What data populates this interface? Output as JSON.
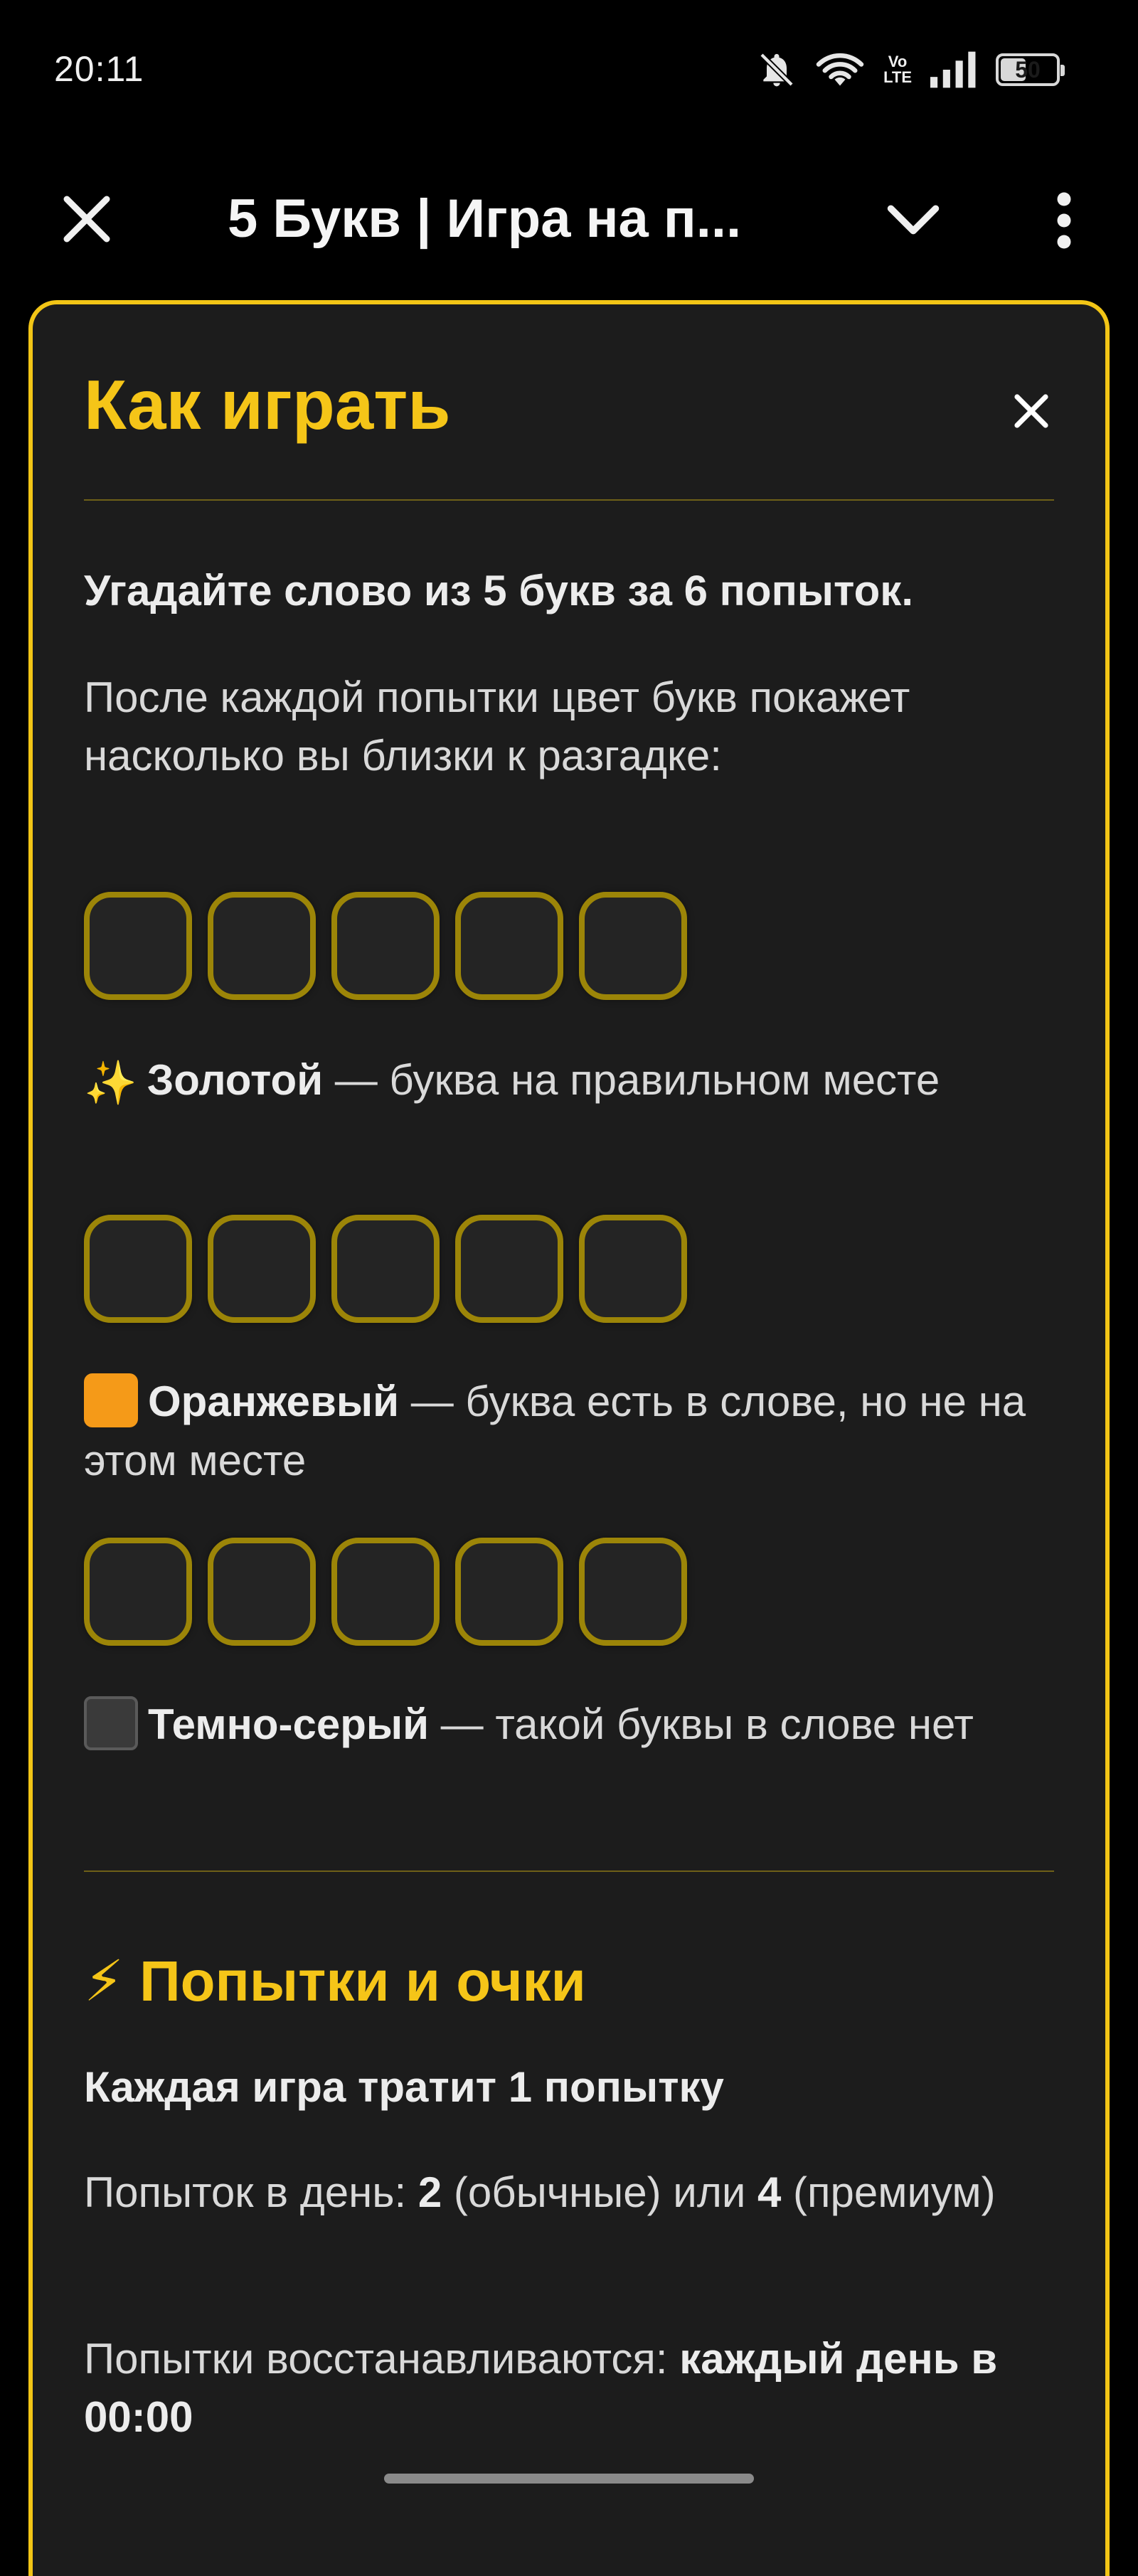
{
  "status_bar": {
    "time": "20:11",
    "network_label_top": "Vo",
    "network_label_bottom": "LTE",
    "battery_level": "50",
    "battery_fraction": 0.5
  },
  "toolbar": {
    "title": "5 Букв | Игра на п..."
  },
  "modal": {
    "title": "Как играть",
    "intro": "Угадайте слово из 5 букв за 6 попыток.",
    "description": "После каждой попытки цвет букв покажет насколько вы близки к разгадке:",
    "legend": [
      {
        "emoji": "✨",
        "name": "Золотой",
        "text": " — буква на правильном месте",
        "color": "#f5c518"
      },
      {
        "emoji": "orange-square",
        "name": "Оранжевый",
        "text": " — буква есть в слове, но не на этом месте",
        "color": "#f59a18"
      },
      {
        "emoji": "dark-square",
        "name": "Темно-серый",
        "text": " — такой буквы в слове нет",
        "color": "#3a3a3a"
      }
    ],
    "attempts_section": {
      "icon": "⚡",
      "title": "Попытки и очки",
      "line1": "Каждая игра тратит 1 попытку",
      "line2_prefix": "Попыток в день: ",
      "line2_regular": "2",
      "line2_regular_label": " (обычные) или ",
      "line2_premium": "4",
      "line2_suffix": " (премиум)",
      "line3_prefix": "Попытки восстанавливаются: ",
      "line3_bold": "каждый день в 00:00"
    }
  },
  "colors": {
    "accent": "#f5c518",
    "tile_border": "#9c8508",
    "modal_bg": "#1c1c1c",
    "modal_border": "#f2c516"
  }
}
